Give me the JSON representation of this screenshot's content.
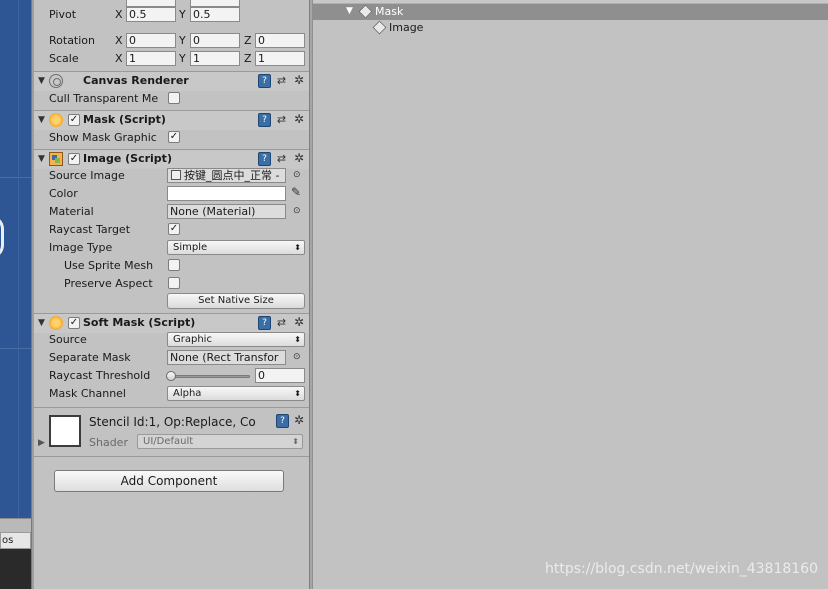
{
  "inspector": {
    "transform": {
      "rows": [
        {
          "label": "Pivot",
          "x": "0.5",
          "y": "0.5"
        },
        {
          "label": "Rotation",
          "x": "0",
          "y": "0",
          "z": "0"
        },
        {
          "label": "Scale",
          "x": "1",
          "y": "1",
          "z": "1"
        }
      ],
      "axis_x": "X",
      "axis_y": "Y",
      "axis_z": "Z"
    },
    "canvas_renderer": {
      "title": "Canvas Renderer",
      "cull_label": "Cull Transparent Me",
      "cull_checked": false
    },
    "mask": {
      "title": "Mask (Script)",
      "enabled": true,
      "show_graphic_label": "Show Mask Graphic",
      "show_graphic_checked": true
    },
    "image": {
      "title": "Image (Script)",
      "enabled": true,
      "source_image_label": "Source Image",
      "source_image_value": "按键_圆点中_正常 -",
      "color_label": "Color",
      "color_value": "#ffffff",
      "material_label": "Material",
      "material_value": "None (Material)",
      "raycast_label": "Raycast Target",
      "raycast_checked": true,
      "image_type_label": "Image Type",
      "image_type_value": "Simple",
      "sprite_mesh_label": "Use Sprite Mesh",
      "preserve_label": "Preserve Aspect",
      "native_size_button": "Set Native Size"
    },
    "soft_mask": {
      "title": "Soft Mask (Script)",
      "enabled": true,
      "source_label": "Source",
      "source_value": "Graphic",
      "separate_label": "Separate Mask",
      "separate_value": "None (Rect Transfor",
      "raycast_threshold_label": "Raycast Threshold",
      "raycast_threshold_value": "0",
      "mask_channel_label": "Mask Channel",
      "mask_channel_value": "Alpha"
    },
    "material_block": {
      "title": "Stencil Id:1, Op:Replace, Co",
      "shader_label": "Shader",
      "shader_value": "UI/Default"
    },
    "add_component": "Add Component"
  },
  "hierarchy": {
    "items": [
      {
        "label": "Mask",
        "selected": true,
        "expanded": true
      },
      {
        "label": "Image",
        "selected": false
      }
    ]
  },
  "bottom_left_tab": "os",
  "watermark": "https://blog.csdn.net/weixin_43818160",
  "glyphs": {
    "check": "✓",
    "fold_open": "▼",
    "fold_closed": "▶",
    "dropdown": "⬍",
    "picker": "⊙",
    "gear": "✲",
    "preset": "⇄",
    "help": "?",
    "eyedropper": "✎"
  }
}
